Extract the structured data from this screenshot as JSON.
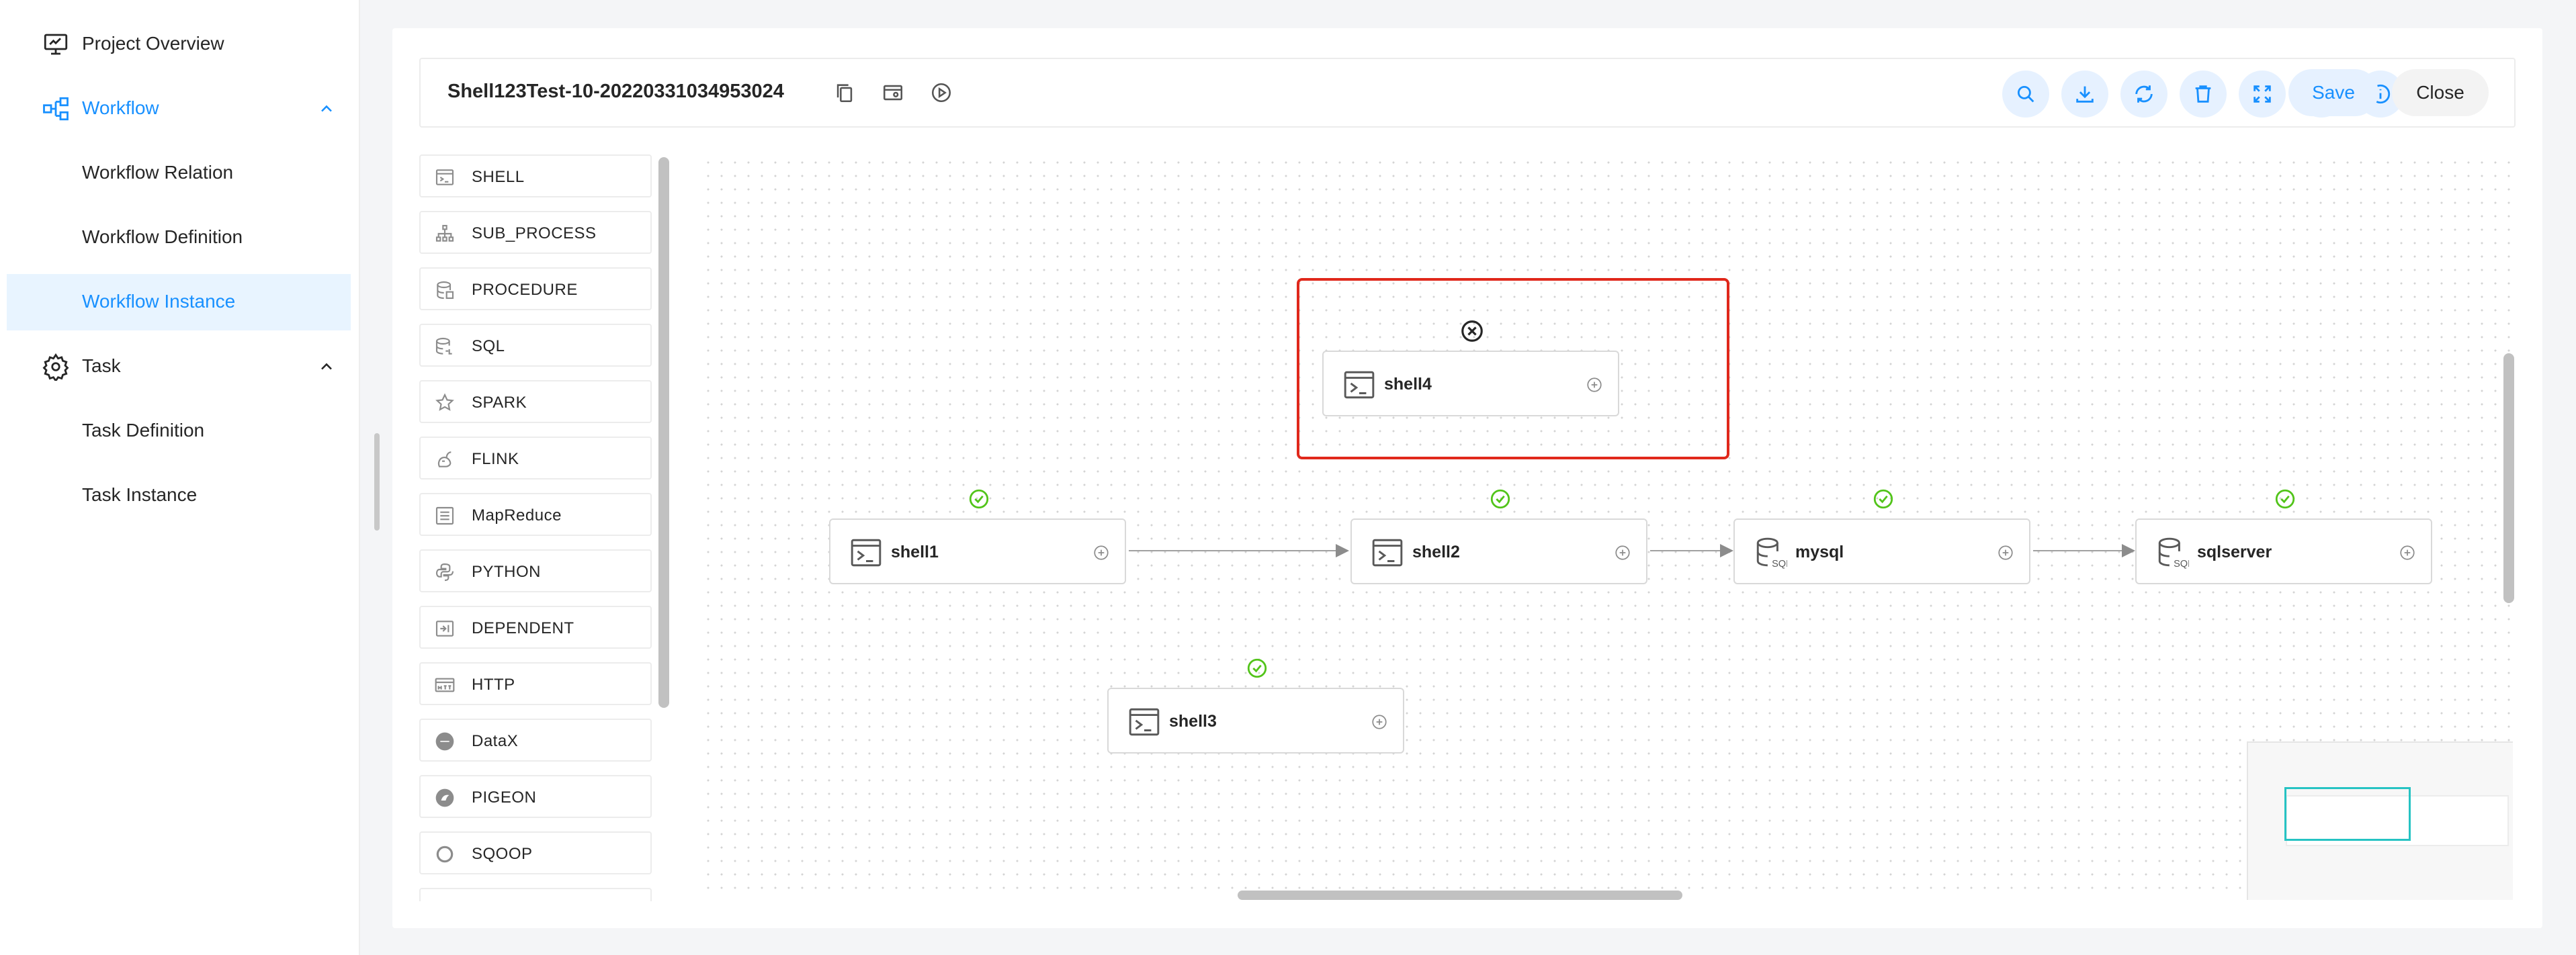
{
  "sidebar": {
    "items": [
      {
        "label": "Project Overview"
      },
      {
        "label": "Workflow"
      },
      {
        "label": "Workflow Relation"
      },
      {
        "label": "Workflow Definition"
      },
      {
        "label": "Workflow Instance"
      },
      {
        "label": "Task"
      },
      {
        "label": "Task Definition"
      },
      {
        "label": "Task Instance"
      }
    ]
  },
  "toolbar": {
    "title": "Shell123Test-10-20220331034953024",
    "save_label": "Save",
    "close_label": "Close"
  },
  "palette": {
    "items": [
      {
        "label": "SHELL"
      },
      {
        "label": "SUB_PROCESS"
      },
      {
        "label": "PROCEDURE"
      },
      {
        "label": "SQL"
      },
      {
        "label": "SPARK"
      },
      {
        "label": "FLINK"
      },
      {
        "label": "MapReduce"
      },
      {
        "label": "PYTHON"
      },
      {
        "label": "DEPENDENT"
      },
      {
        "label": "HTTP"
      },
      {
        "label": "DataX"
      },
      {
        "label": "PIGEON"
      },
      {
        "label": "SQOOP"
      }
    ]
  },
  "canvas": {
    "nodes": [
      {
        "label": "shell4",
        "status": "none",
        "selected": true
      },
      {
        "label": "shell1",
        "status": "success"
      },
      {
        "label": "shell2",
        "status": "success"
      },
      {
        "label": "mysql",
        "status": "success"
      },
      {
        "label": "sqlserver",
        "status": "success"
      },
      {
        "label": "shell3",
        "status": "success"
      }
    ]
  },
  "colors": {
    "accent": "#1890ff",
    "accent_light": "#e6f1ff",
    "success": "#52c41a",
    "selection": "#e0281b",
    "minimap_view": "#26c3c3"
  }
}
